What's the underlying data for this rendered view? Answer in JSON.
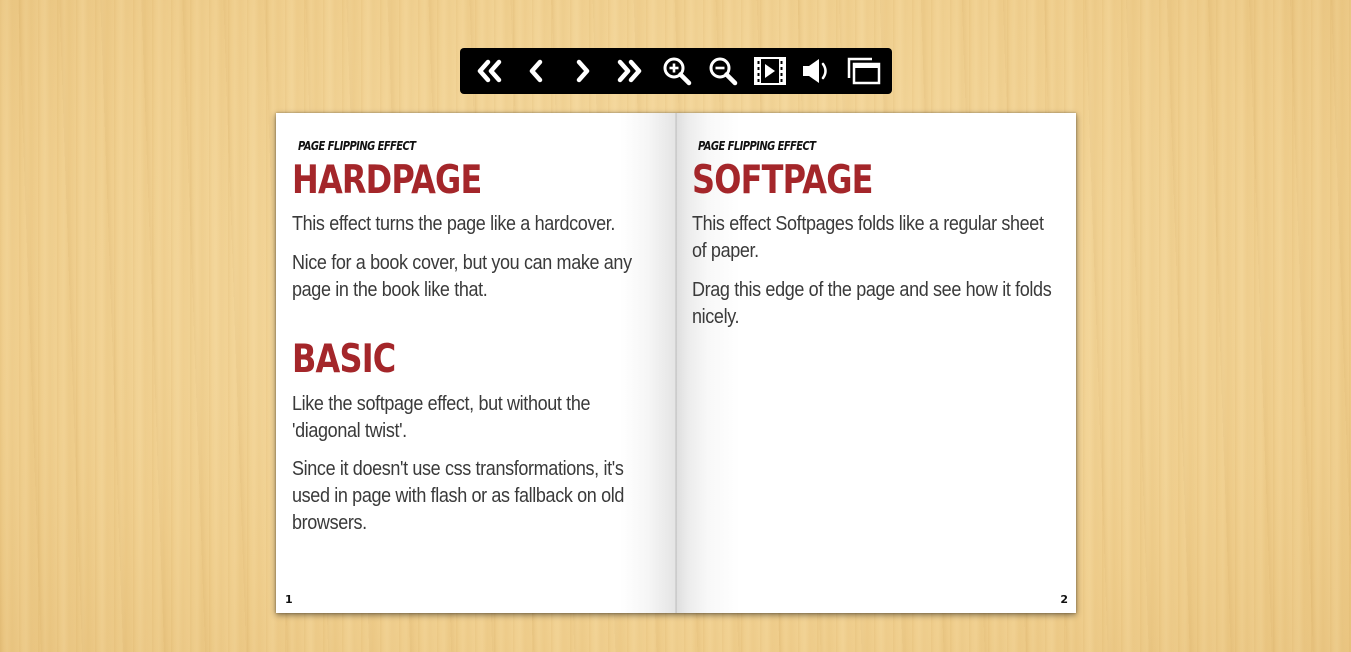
{
  "toolbar": {
    "buttons": [
      {
        "icon": "double-chevron-left-icon",
        "label": "First page"
      },
      {
        "icon": "chevron-left-icon",
        "label": "Previous page"
      },
      {
        "icon": "chevron-right-icon",
        "label": "Next page"
      },
      {
        "icon": "double-chevron-right-icon",
        "label": "Last page"
      },
      {
        "icon": "zoom-in-icon",
        "label": "Zoom in"
      },
      {
        "icon": "zoom-out-icon",
        "label": "Zoom out"
      },
      {
        "icon": "slideshow-icon",
        "label": "Slideshow"
      },
      {
        "icon": "sound-icon",
        "label": "Sound"
      },
      {
        "icon": "fullscreen-icon",
        "label": "Full screen"
      }
    ]
  },
  "book": {
    "left_page": {
      "kicker": "PAGE FLIPPING EFFECT",
      "sections": [
        {
          "heading": "HARDPAGE",
          "paragraphs": [
            "This effect turns the page like a hardcover.",
            "Nice for a book cover, but you can make any page in the book like that."
          ]
        },
        {
          "heading": "BASIC",
          "paragraphs": [
            "Like the softpage effect, but without the 'diagonal twist'.",
            "Since it doesn't use css transformations, it's used in page with flash or as fallback on old browsers."
          ]
        }
      ],
      "page_number": "1"
    },
    "right_page": {
      "kicker": "PAGE FLIPPING EFFECT",
      "sections": [
        {
          "heading": "SOFTPAGE",
          "paragraphs": [
            "This effect Softpages folds like a regular sheet of paper.",
            "Drag this edge of the page and see how it folds nicely."
          ]
        }
      ],
      "page_number": "2"
    }
  },
  "colors": {
    "heading": "#a4262a",
    "body_text": "#3a3a3a",
    "toolbar_bg": "#000000",
    "background_wood": "#f1d192"
  }
}
